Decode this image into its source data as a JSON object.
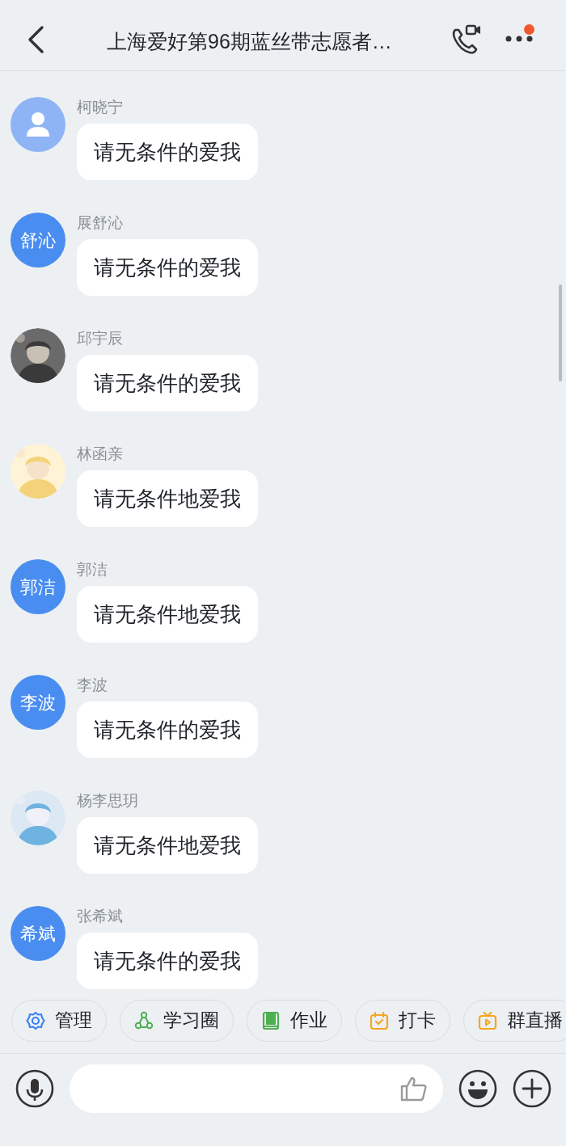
{
  "header": {
    "title": "上海爱好第96期蓝丝带志愿者…",
    "unread_dot": true
  },
  "messages": [
    {
      "sender": "柯晓宁",
      "avatar": {
        "kind": "default"
      },
      "text": "请无条件的爱我"
    },
    {
      "sender": "展舒沁",
      "avatar": {
        "kind": "initials",
        "text": "舒沁"
      },
      "text": "请无条件的爱我"
    },
    {
      "sender": "邱宇辰",
      "text": "请无条件的爱我"
    },
    {
      "sender": "林函亲",
      "text": "请无条件地爱我"
    },
    {
      "sender": "郭洁",
      "avatar": {
        "kind": "initials",
        "text": "郭洁"
      },
      "text": "请无条件地爱我"
    },
    {
      "sender": "李波",
      "avatar": {
        "kind": "initials",
        "text": "李波"
      },
      "text": "请无条件的爱我"
    },
    {
      "sender": "杨李思玥",
      "text": "请无条件地爱我"
    },
    {
      "sender": "张希斌",
      "avatar": {
        "kind": "initials",
        "text": "希斌"
      },
      "text": "请无条件的爱我"
    }
  ],
  "shortcuts": [
    {
      "label": "管理",
      "kind": "gear",
      "color": "#3b82f6"
    },
    {
      "label": "学习圈",
      "kind": "circle",
      "color": "#4caf50"
    },
    {
      "label": "作业",
      "kind": "book",
      "color": "#4caf50"
    },
    {
      "label": "打卡",
      "kind": "checkin",
      "color": "#f5a623"
    },
    {
      "label": "群直播",
      "kind": "live",
      "color": "#f5a623"
    }
  ]
}
